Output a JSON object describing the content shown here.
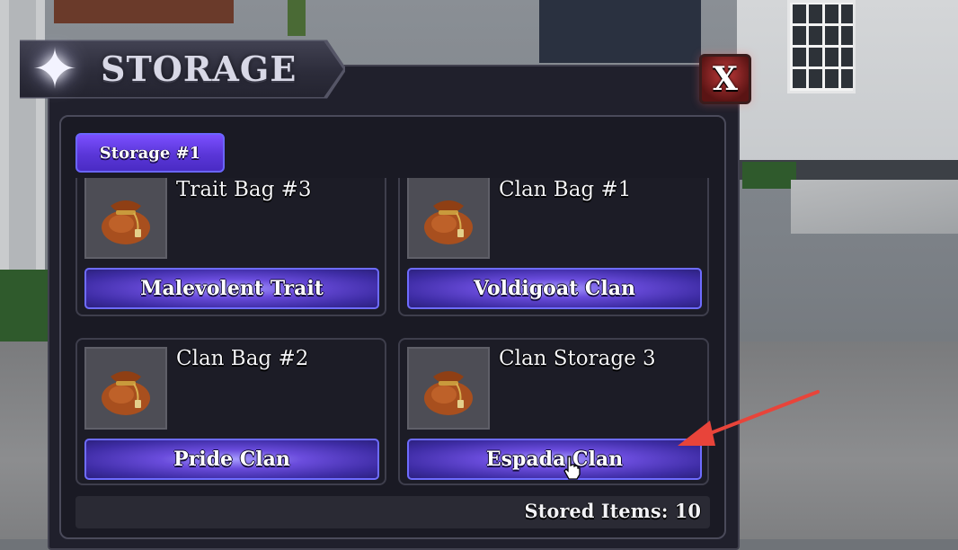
{
  "window": {
    "title": "STORAGE",
    "close_label": "X"
  },
  "tabs": [
    {
      "label": "Storage #1",
      "active": true
    }
  ],
  "items": [
    {
      "name": "Trait Bag #3",
      "button": "Malevolent Trait",
      "icon": "loot-bag-icon"
    },
    {
      "name": "Clan Bag #1",
      "button": "Voldigoat Clan",
      "icon": "loot-bag-icon"
    },
    {
      "name": "Clan Bag #2",
      "button": "Pride Clan",
      "icon": "loot-bag-icon"
    },
    {
      "name": "Clan Storage 3",
      "button": "Espada Clan",
      "icon": "loot-bag-icon"
    }
  ],
  "footer": {
    "stored_items": "Stored Items: 10"
  },
  "colors": {
    "accent_purple": "#5a36d8",
    "close_red": "#c03a3a",
    "annotation_arrow": "#e8443a"
  }
}
